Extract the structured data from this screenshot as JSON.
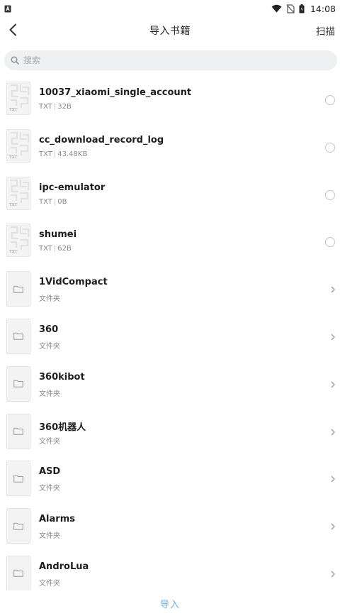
{
  "status_bar": {
    "time": "14:08",
    "icons": [
      "a-app-icon",
      "wifi-icon",
      "no-sim-icon",
      "battery-icon"
    ]
  },
  "header": {
    "title": "导入书籍",
    "back_icon": "chevron-left-icon",
    "scan_label": "扫描"
  },
  "search": {
    "placeholder": "搜索",
    "value": ""
  },
  "files": [
    {
      "name": "10037_xiaomi_single_account",
      "type": "TXT",
      "size": "32B",
      "selected": false
    },
    {
      "name": "cc_download_record_log",
      "type": "TXT",
      "size": "43.48KB",
      "selected": false
    },
    {
      "name": "ipc-emulator",
      "type": "TXT",
      "size": "0B",
      "selected": false
    },
    {
      "name": "shumei",
      "type": "TXT",
      "size": "62B",
      "selected": false
    }
  ],
  "folders": [
    {
      "name": "1VidCompact",
      "subtitle": "文件夹"
    },
    {
      "name": "360",
      "subtitle": "文件夹"
    },
    {
      "name": "360kibot",
      "subtitle": "文件夹"
    },
    {
      "name": "360机器人",
      "subtitle": "文件夹"
    },
    {
      "name": "ASD",
      "subtitle": "文件夹"
    },
    {
      "name": "Alarms",
      "subtitle": "文件夹"
    },
    {
      "name": "AndroLua",
      "subtitle": "文件夹"
    }
  ],
  "thumb_label": "TXT",
  "separator": "|",
  "bottom": {
    "import_label": "导入"
  },
  "colors": {
    "accent": "#6aaee4",
    "search_bg": "#eef0f2",
    "subtitle": "#8a8a8a"
  }
}
